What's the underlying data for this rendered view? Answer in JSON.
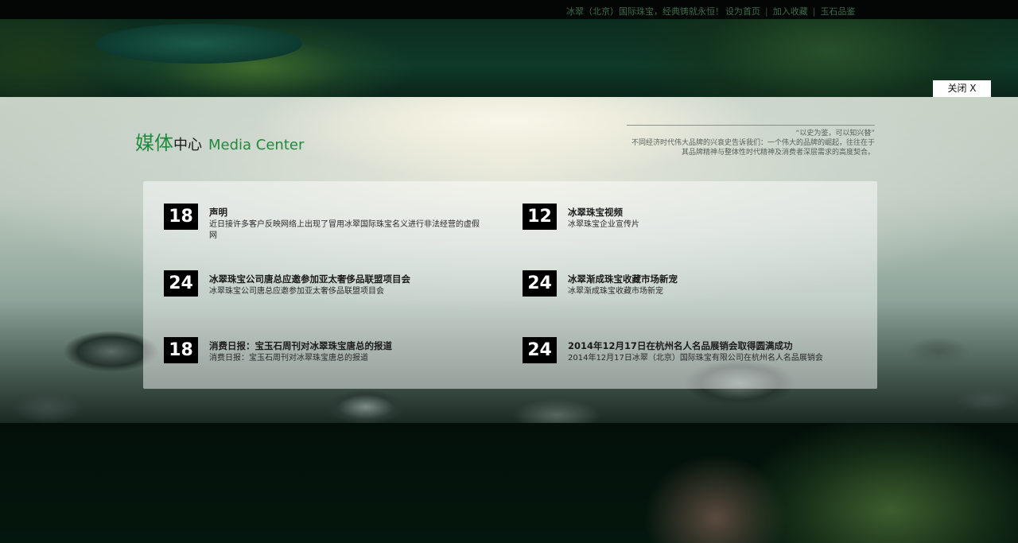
{
  "topbar": {
    "tagline": "冰翠（北京）国际珠宝，经典铸就永恒！",
    "links": [
      "设为首页",
      "加入收藏",
      "玉石品鉴"
    ],
    "separator": "|"
  },
  "close_button": "关闭 X",
  "section": {
    "title_green": "媒体",
    "title_black": "中心",
    "title_en": "Media Center"
  },
  "quote": {
    "line1": "“以史为鉴，可以知兴替”",
    "line2": "不同经济时代伟大品牌的兴衰史告诉我们：一个伟大的品牌的崛起，往往在于",
    "line3": "其品牌精神与整体性时代精神及消费者深层需求的高度契合。"
  },
  "news": [
    {
      "day": "18",
      "title": "声明",
      "desc": "近日接许多客户反映网络上出现了冒用冰翠国际珠宝名义进行非法经营的虚假网"
    },
    {
      "day": "12",
      "title": "冰翠珠宝视频",
      "desc": "冰翠珠宝企业宣传片"
    },
    {
      "day": "24",
      "title": "冰翠珠宝公司唐总应邀参加亚太奢侈品联盟项目会",
      "desc": "冰翠珠宝公司唐总应邀参加亚太奢侈品联盟项目会"
    },
    {
      "day": "24",
      "title": "冰翠渐成珠宝收藏市场新宠",
      "desc": "冰翠渐成珠宝收藏市场新宠"
    },
    {
      "day": "18",
      "title": "消费日报：宝玉石周刊对冰翠珠宝唐总的报道",
      "desc": "消费日报：宝玉石周刊对冰翠珠宝唐总的报道"
    },
    {
      "day": "24",
      "title": "2014年12月17日在杭州名人名品展销会取得圆满成功",
      "desc": "2014年12月17日冰翠（北京）国际珠宝有限公司在杭州名人名品展销会"
    }
  ]
}
